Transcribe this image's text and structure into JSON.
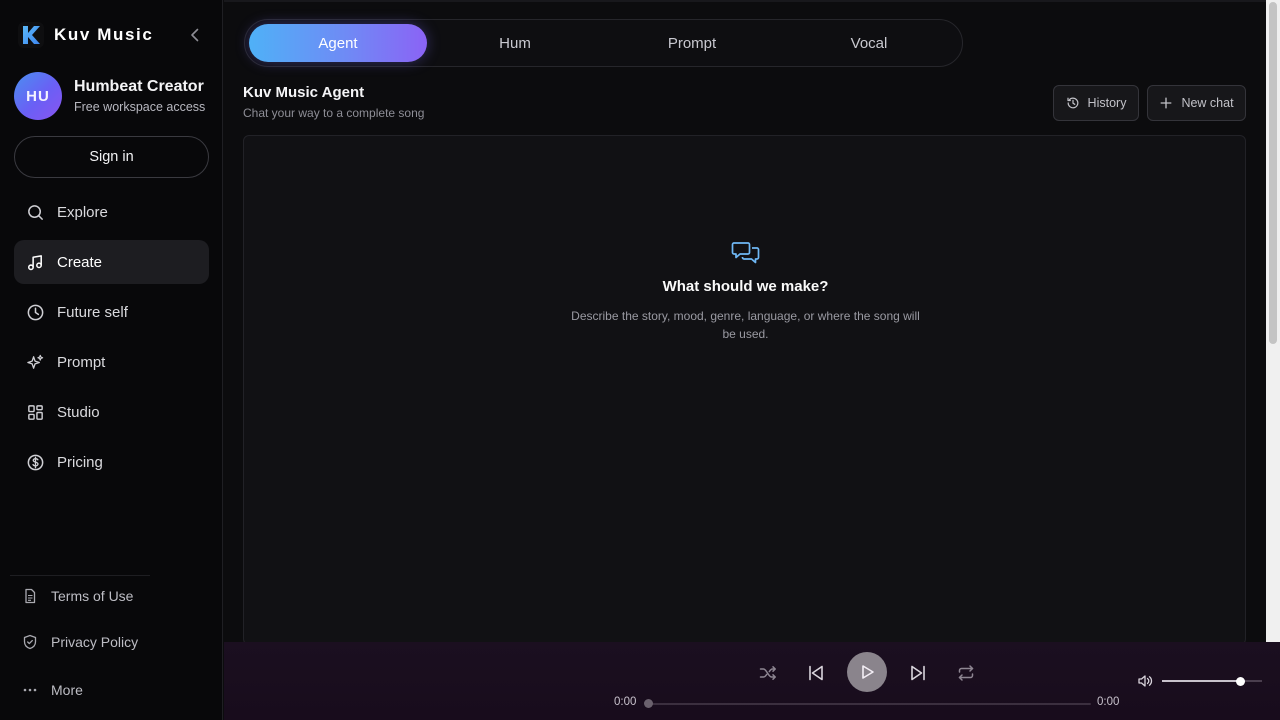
{
  "brand": {
    "name": "Kuv Music"
  },
  "profile": {
    "initials": "HU",
    "name": "Humbeat Creator",
    "subtitle": "Free workspace access"
  },
  "sidebar": {
    "sign_in_label": "Sign in",
    "nav": [
      {
        "label": "Explore",
        "icon": "search-icon"
      },
      {
        "label": "Create",
        "icon": "music-note-icon",
        "active": true
      },
      {
        "label": "Future self",
        "icon": "clock-icon"
      },
      {
        "label": "Prompt",
        "icon": "sparkles-icon"
      },
      {
        "label": "Studio",
        "icon": "grid-icon"
      },
      {
        "label": "Pricing",
        "icon": "dollar-circle-icon"
      }
    ],
    "footer": [
      {
        "label": "Terms of Use",
        "icon": "document-icon"
      },
      {
        "label": "Privacy Policy",
        "icon": "shield-icon"
      },
      {
        "label": "More",
        "icon": "more-dots-icon"
      }
    ]
  },
  "tabs": [
    {
      "label": "Agent",
      "active": true
    },
    {
      "label": "Hum"
    },
    {
      "label": "Prompt"
    },
    {
      "label": "Vocal"
    }
  ],
  "section": {
    "title": "Kuv Music Agent",
    "subtitle": "Chat your way to a complete song",
    "history_label": "History",
    "new_chat_label": "New chat"
  },
  "empty_state": {
    "icon": "chat-bubbles-icon",
    "title": "What should we make?",
    "description": "Describe the story, mood, genre, language, or where the song will be used."
  },
  "player": {
    "elapsed": "0:00",
    "duration": "0:00",
    "progress": 0,
    "volume": 0.78
  },
  "colors": {
    "accent_start": "#4fb1f7",
    "accent_end": "#8b63f5",
    "empty_icon": "#6fb8f5"
  }
}
